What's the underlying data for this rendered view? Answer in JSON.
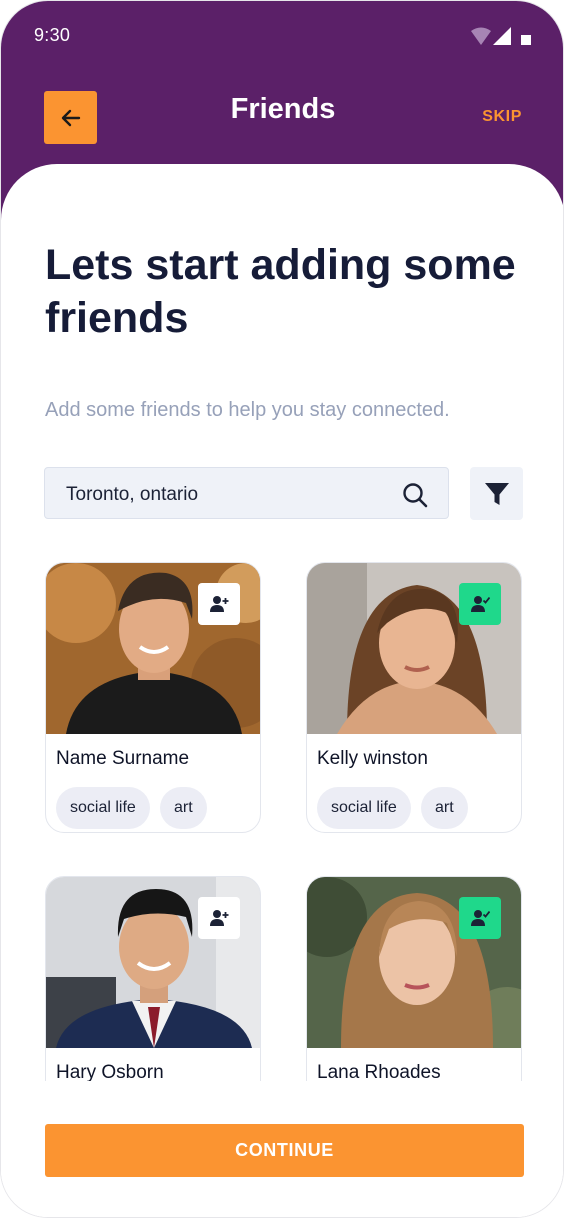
{
  "status_bar": {
    "time": "9:30"
  },
  "header": {
    "title": "Friends",
    "skip_label": "SKIP",
    "back_icon": "arrow-left-icon"
  },
  "content": {
    "headline": "Lets start adding some friends",
    "subtitle": "Add some friends to help you stay connected."
  },
  "search": {
    "value": "Toronto, ontario",
    "icon": "search-icon",
    "filter_icon": "filter-icon"
  },
  "friends": [
    {
      "name": "Name Surname",
      "tags": [
        "social life",
        "art"
      ],
      "added": false
    },
    {
      "name": "Kelly winston",
      "tags": [
        "social life",
        "art"
      ],
      "added": true
    },
    {
      "name": "Hary Osborn",
      "tags": [],
      "added": false
    },
    {
      "name": "Lana Rhoades",
      "tags": [],
      "added": true
    }
  ],
  "footer": {
    "continue_label": "CONTINUE"
  },
  "colors": {
    "header_bg": "#5b2068",
    "accent_orange": "#fb9431",
    "added_green": "#1fd88b",
    "headline": "#161c38",
    "subtitle": "#97a1b9"
  }
}
